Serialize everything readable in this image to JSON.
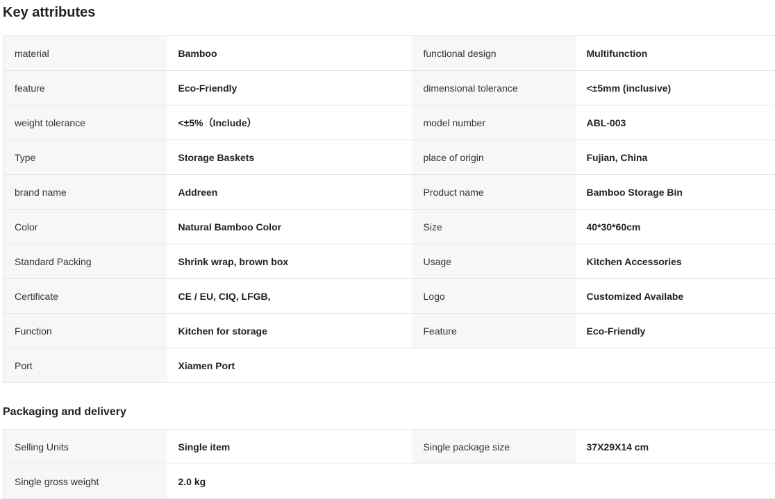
{
  "key_attributes": {
    "title": "Key attributes",
    "rows": [
      [
        "material",
        "Bamboo",
        "functional design",
        "Multifunction"
      ],
      [
        "feature",
        "Eco-Friendly",
        "dimensional tolerance",
        "<±5mm (inclusive)"
      ],
      [
        "weight tolerance",
        "<±5%（Include）",
        "model number",
        "ABL-003"
      ],
      [
        "Type",
        "Storage Baskets",
        "place of origin",
        "Fujian, China"
      ],
      [
        "brand name",
        "Addreen",
        "Product name",
        "Bamboo Storage Bin"
      ],
      [
        "Color",
        "Natural Bamboo Color",
        "Size",
        "40*30*60cm"
      ],
      [
        "Standard Packing",
        "Shrink wrap, brown box",
        "Usage",
        "Kitchen Accessories"
      ],
      [
        "Certificate",
        "CE / EU, CIQ, LFGB,",
        "Logo",
        "Customized Availabe"
      ],
      [
        "Function",
        "Kitchen for storage",
        "Feature",
        "Eco-Friendly"
      ],
      [
        "Port",
        "Xiamen Port",
        "",
        ""
      ]
    ]
  },
  "packaging": {
    "title": "Packaging and delivery",
    "rows": [
      [
        "Selling Units",
        "Single item",
        "Single package size",
        "37X29X14 cm"
      ],
      [
        "Single gross weight",
        "2.0 kg",
        "",
        ""
      ]
    ]
  }
}
